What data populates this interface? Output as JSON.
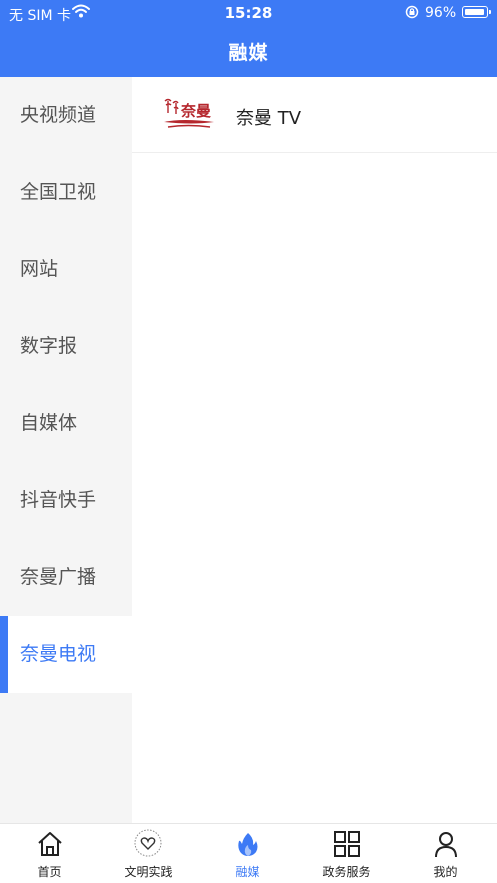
{
  "status_bar": {
    "carrier": "无 SIM 卡",
    "time": "15:28",
    "battery_percent": "96%",
    "battery_level": 0.96
  },
  "header": {
    "title": "融媒"
  },
  "sidebar": {
    "items": [
      {
        "label": "央视频道",
        "active": false
      },
      {
        "label": "全国卫视",
        "active": false
      },
      {
        "label": "网站",
        "active": false
      },
      {
        "label": "数字报",
        "active": false
      },
      {
        "label": "自媒体",
        "active": false
      },
      {
        "label": "抖音快手",
        "active": false
      },
      {
        "label": "奈曼广播",
        "active": false
      },
      {
        "label": "奈曼电视",
        "active": true
      }
    ]
  },
  "content": {
    "channels": [
      {
        "name": "奈曼 TV",
        "logo_text": "奈曼",
        "logo_icon": "naiman-tv-logo"
      }
    ]
  },
  "tabbar": {
    "items": [
      {
        "label": "首页",
        "icon": "home-icon",
        "active": false
      },
      {
        "label": "文明实践",
        "icon": "civilization-practice-icon",
        "active": false
      },
      {
        "label": "融媒",
        "icon": "flame-icon",
        "active": true
      },
      {
        "label": "政务服务",
        "icon": "grid-icon",
        "active": false
      },
      {
        "label": "我的",
        "icon": "user-icon",
        "active": false
      }
    ]
  },
  "colors": {
    "accent": "#3d7af5",
    "sidebar_bg": "#f5f5f5",
    "logo_red": "#b5272d"
  }
}
